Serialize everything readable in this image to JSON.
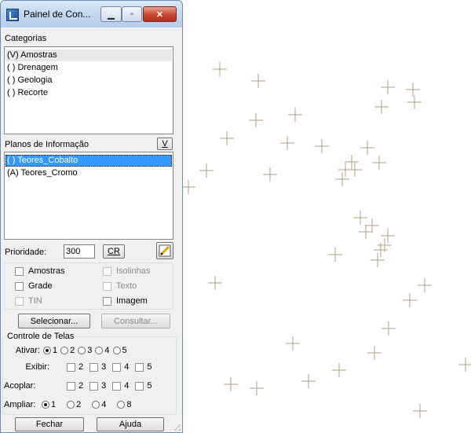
{
  "window": {
    "title": "Painel de Con..."
  },
  "categorias": {
    "label": "Categorias",
    "items": [
      "(V) Amostras",
      "( ) Drenagem",
      "( ) Geologia",
      "( ) Recorte"
    ]
  },
  "planos": {
    "label": "Planos de Informação",
    "v_button": "V",
    "items": [
      "( ) Teores_Cobalto",
      "(A) Teores_Cromo"
    ]
  },
  "prioridade": {
    "label": "Prioridade:",
    "value": "300",
    "cr_button": "CR"
  },
  "representacoes": {
    "amostras": "Amostras",
    "isolinhas": "Isolinhas",
    "grade": "Grade",
    "texto": "Texto",
    "tin": "TIN",
    "imagem": "Imagem"
  },
  "actions": {
    "selecionar": "Selecionar...",
    "consultar": "Consultar..."
  },
  "controle": {
    "label": "Controle de Telas",
    "ativar_label": "Ativar:",
    "exibir_label": "Exibir:",
    "acoplar_label": "Acoplar:",
    "ampliar_label": "Ampliar:",
    "n1": "1",
    "n2": "2",
    "n3": "3",
    "n4": "4",
    "n5": "5",
    "n8": "8"
  },
  "footer": {
    "fechar": "Fechar",
    "ajuda": "Ajuda"
  },
  "colors": {
    "marker": "#b0a07e",
    "selection": "#3399ff"
  },
  "map": {
    "marker_shape": "plus"
  }
}
